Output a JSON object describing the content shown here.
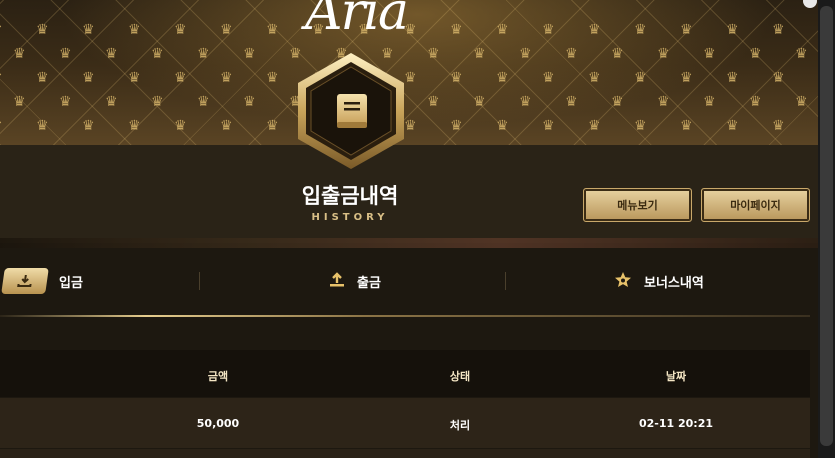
{
  "brand": {
    "logo_text": "Aria"
  },
  "header": {
    "title": "입출금내역",
    "subtitle": "HISTORY",
    "menu_button": "메뉴보기",
    "mypage_button": "마이페이지"
  },
  "tabs": [
    {
      "label": "입금",
      "icon": "download-icon",
      "active": true
    },
    {
      "label": "출금",
      "icon": "upload-icon",
      "active": false
    },
    {
      "label": "보너스내역",
      "icon": "star-icon",
      "active": false
    }
  ],
  "table": {
    "headers": [
      "금액",
      "상태",
      "날짜"
    ],
    "rows": [
      [
        "50,000",
        "처리",
        "02-11 20:21"
      ]
    ]
  },
  "colors": {
    "gold": "#d9bf86",
    "gold_light": "#f0dca8",
    "background": "#1f1a12"
  }
}
